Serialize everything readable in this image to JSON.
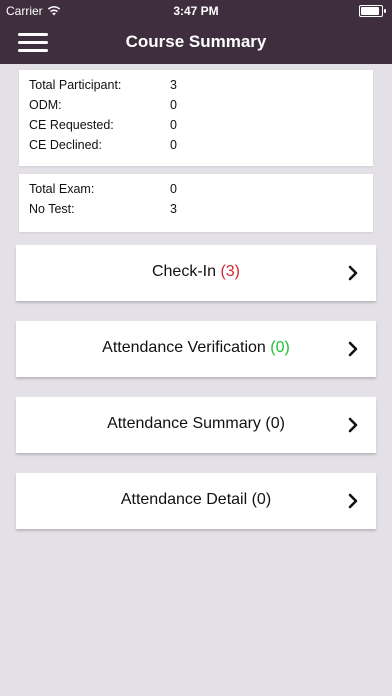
{
  "status_bar": {
    "carrier": "Carrier",
    "time": "3:47 PM",
    "wifi_icon": "wifi-icon",
    "battery_icon": "battery-icon"
  },
  "nav": {
    "title": "Course Summary",
    "menu_icon": "hamburger-menu-icon"
  },
  "summary": {
    "total_participant": {
      "label": "Total Participant:",
      "value": "3"
    },
    "odm": {
      "label": "ODM:",
      "value": "0"
    },
    "ce_requested": {
      "label": "CE Requested:",
      "value": "0"
    },
    "ce_declined": {
      "label": "CE Declined:",
      "value": "0"
    }
  },
  "exams": {
    "total_exam": {
      "label": "Total Exam:",
      "value": "0"
    },
    "no_test": {
      "label": "No Test:",
      "value": "3"
    }
  },
  "actions": [
    {
      "label": "Check-In",
      "count": "(3)",
      "count_color": "#d0282c"
    },
    {
      "label": "Attendance Verification",
      "count": "(0)",
      "count_color": "#22c032"
    },
    {
      "label": "Attendance Summary (0)",
      "count": "",
      "count_color": ""
    },
    {
      "label": "Attendance Detail (0)",
      "count": "",
      "count_color": ""
    }
  ],
  "colors": {
    "nav_background": "#3f2e3e",
    "page_background": "#e3e0e7"
  }
}
